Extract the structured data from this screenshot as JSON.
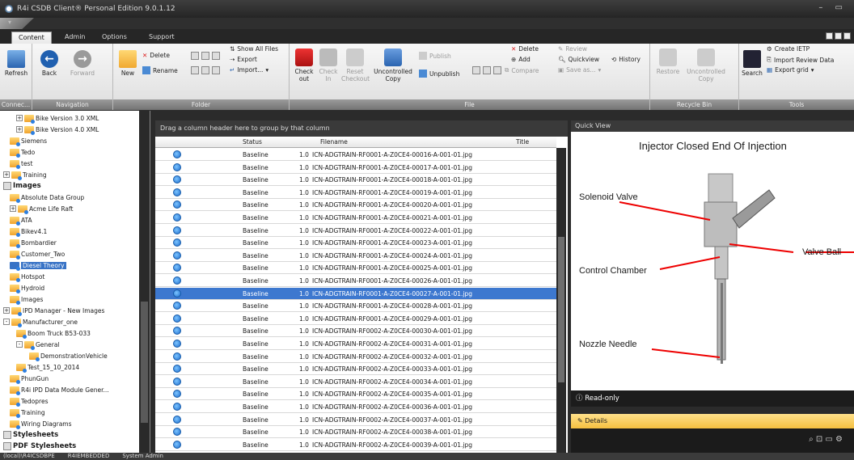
{
  "window": {
    "title": "R4i CSDB Client® Personal Edition 9.0.1.12"
  },
  "tabs": [
    "Content",
    "Admin",
    "Options",
    "Support"
  ],
  "ribbon": {
    "refresh": "Refresh",
    "back": "Back",
    "forward": "Forward",
    "new": "New",
    "delete": "Delete",
    "rename": "Rename",
    "show_all_files": "Show All Files",
    "export": "Export",
    "import": "Import...",
    "check_out": "Check out",
    "check_in": "Check In",
    "reset_checkout": "Reset Checkout",
    "uncontrolled_copy": "Uncontrolled Copy",
    "publish": "Publish",
    "unpublish": "Unpublish",
    "f_delete": "Delete",
    "add": "Add",
    "compare": "Compare",
    "review": "Review",
    "quickview": "Quickview",
    "history": "History",
    "save_as": "Save as...",
    "restore": "Restore",
    "uncontrolled_copy2": "Uncontrolled Copy",
    "search": "Search",
    "create_ietp": "Create IETP",
    "import_review": "Import Review Data",
    "export_grid": "Export grid",
    "groups": [
      "Connec...",
      "Navigation",
      "Folder",
      "File",
      "Recycle Bin",
      "Tools"
    ]
  },
  "tree": [
    {
      "label": "Bike Version 3.0 XML",
      "indent": 2,
      "exp": "+"
    },
    {
      "label": "Bike Version 4.0 XML",
      "indent": 2,
      "exp": "+"
    },
    {
      "label": "Siemens",
      "indent": 1
    },
    {
      "label": "Tedo",
      "indent": 1
    },
    {
      "label": "test",
      "indent": 1
    },
    {
      "label": "Training",
      "indent": 0,
      "exp": "+"
    },
    {
      "label": "Images",
      "indent": 0,
      "hdr": true
    },
    {
      "label": "Absolute Data Group",
      "indent": 1
    },
    {
      "label": "Acme Life Raft",
      "indent": 1,
      "exp": "+"
    },
    {
      "label": "ATA",
      "indent": 1
    },
    {
      "label": "Bikev4.1",
      "indent": 1
    },
    {
      "label": "Bombardier",
      "indent": 1
    },
    {
      "label": "Customer_Two",
      "indent": 1
    },
    {
      "label": "Diesel Theory",
      "indent": 1,
      "sel": true
    },
    {
      "label": "Hotspot",
      "indent": 1
    },
    {
      "label": "Hydroid",
      "indent": 1
    },
    {
      "label": "Images",
      "indent": 1
    },
    {
      "label": "IPD Manager - New Images",
      "indent": 0,
      "exp": "+"
    },
    {
      "label": "Manufacturer_one",
      "indent": 0,
      "exp": "-"
    },
    {
      "label": "Boom Truck B53-033",
      "indent": 2
    },
    {
      "label": "General",
      "indent": 2,
      "exp": "-"
    },
    {
      "label": "DemonstrationVehicle",
      "indent": 4
    },
    {
      "label": "Test_15_10_2014",
      "indent": 2
    },
    {
      "label": "PhunGun",
      "indent": 1
    },
    {
      "label": "R4i IPD Data Module Gener...",
      "indent": 1
    },
    {
      "label": "Tedopres",
      "indent": 1
    },
    {
      "label": "Training",
      "indent": 1
    },
    {
      "label": "Wiring Diagrams",
      "indent": 1
    },
    {
      "label": "Stylesheets",
      "indent": 0,
      "hdr": true
    },
    {
      "label": "PDF Stylesheets",
      "indent": 0,
      "hdr": true
    }
  ],
  "grid": {
    "group_hint": "Drag a column header here to group by that column",
    "headers": {
      "status": "Status",
      "filename": "Filename",
      "title": "Title"
    },
    "rows": [
      {
        "status": "Baseline",
        "ver": "1.0",
        "file": "ICN-ADGTRAIN-RF0001-A-Z0CE4-00016-A-001-01.jpg"
      },
      {
        "status": "Baseline",
        "ver": "1.0",
        "file": "ICN-ADGTRAIN-RF0001-A-Z0CE4-00017-A-001-01.jpg"
      },
      {
        "status": "Baseline",
        "ver": "1.0",
        "file": "ICN-ADGTRAIN-RF0001-A-Z0CE4-00018-A-001-01.jpg"
      },
      {
        "status": "Baseline",
        "ver": "1.0",
        "file": "ICN-ADGTRAIN-RF0001-A-Z0CE4-00019-A-001-01.jpg"
      },
      {
        "status": "Baseline",
        "ver": "1.0",
        "file": "ICN-ADGTRAIN-RF0001-A-Z0CE4-00020-A-001-01.jpg"
      },
      {
        "status": "Baseline",
        "ver": "1.0",
        "file": "ICN-ADGTRAIN-RF0001-A-Z0CE4-00021-A-001-01.jpg"
      },
      {
        "status": "Baseline",
        "ver": "1.0",
        "file": "ICN-ADGTRAIN-RF0001-A-Z0CE4-00022-A-001-01.jpg"
      },
      {
        "status": "Baseline",
        "ver": "1.0",
        "file": "ICN-ADGTRAIN-RF0001-A-Z0CE4-00023-A-001-01.jpg"
      },
      {
        "status": "Baseline",
        "ver": "1.0",
        "file": "ICN-ADGTRAIN-RF0001-A-Z0CE4-00024-A-001-01.jpg"
      },
      {
        "status": "Baseline",
        "ver": "1.0",
        "file": "ICN-ADGTRAIN-RF0001-A-Z0CE4-00025-A-001-01.jpg"
      },
      {
        "status": "Baseline",
        "ver": "1.0",
        "file": "ICN-ADGTRAIN-RF0001-A-Z0CE4-00026-A-001-01.jpg"
      },
      {
        "status": "Baseline",
        "ver": "1.0",
        "file": "ICN-ADGTRAIN-RF0001-A-Z0CE4-00027-A-001-01.jpg",
        "sel": true
      },
      {
        "status": "Baseline",
        "ver": "1.0",
        "file": "ICN-ADGTRAIN-RF0001-A-Z0CE4-00028-A-001-01.jpg"
      },
      {
        "status": "Baseline",
        "ver": "1.0",
        "file": "ICN-ADGTRAIN-RF0001-A-Z0CE4-00029-A-001-01.jpg"
      },
      {
        "status": "Baseline",
        "ver": "1.0",
        "file": "ICN-ADGTRAIN-RF0002-A-Z0CE4-00030-A-001-01.jpg"
      },
      {
        "status": "Baseline",
        "ver": "1.0",
        "file": "ICN-ADGTRAIN-RF0002-A-Z0CE4-00031-A-001-01.jpg"
      },
      {
        "status": "Baseline",
        "ver": "1.0",
        "file": "ICN-ADGTRAIN-RF0002-A-Z0CE4-00032-A-001-01.jpg"
      },
      {
        "status": "Baseline",
        "ver": "1.0",
        "file": "ICN-ADGTRAIN-RF0002-A-Z0CE4-00033-A-001-01.jpg"
      },
      {
        "status": "Baseline",
        "ver": "1.0",
        "file": "ICN-ADGTRAIN-RF0002-A-Z0CE4-00034-A-001-01.jpg"
      },
      {
        "status": "Baseline",
        "ver": "1.0",
        "file": "ICN-ADGTRAIN-RF0002-A-Z0CE4-00035-A-001-01.jpg"
      },
      {
        "status": "Baseline",
        "ver": "1.0",
        "file": "ICN-ADGTRAIN-RF0002-A-Z0CE4-00036-A-001-01.jpg"
      },
      {
        "status": "Baseline",
        "ver": "1.0",
        "file": "ICN-ADGTRAIN-RF0002-A-Z0CE4-00037-A-001-01.jpg"
      },
      {
        "status": "Baseline",
        "ver": "1.0",
        "file": "ICN-ADGTRAIN-RF0002-A-Z0CE4-00038-A-001-01.jpg"
      },
      {
        "status": "Baseline",
        "ver": "1.0",
        "file": "ICN-ADGTRAIN-RF0002-A-Z0CE4-00039-A-001-01.jpg"
      }
    ]
  },
  "quickview": {
    "header": "Quick View",
    "title": "Injector Closed End Of Injection",
    "labels": {
      "solenoid": "Solenoid Valve",
      "valve_ball": "Valve Ball",
      "control": "Control Chamber",
      "nozzle": "Nozzle Needle"
    },
    "readonly": "Read-only",
    "details": "Details"
  },
  "status": {
    "server": "(local)\\R4ICSDBPE",
    "db": "R4IEMBEDDED",
    "user": "System Admin"
  }
}
